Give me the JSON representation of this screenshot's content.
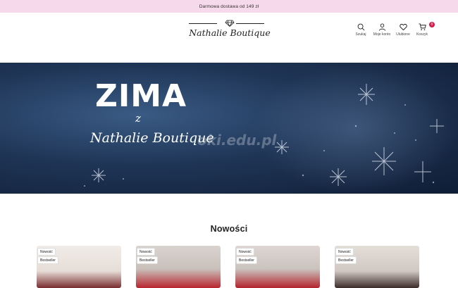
{
  "promo": {
    "text": "Darmowa dostawa od 149 zł"
  },
  "header": {
    "logo_text": "Nathalie Boutique",
    "actions": [
      {
        "label": "Szukaj",
        "icon": "search-icon"
      },
      {
        "label": "Moje konto",
        "icon": "user-icon"
      },
      {
        "label": "Ulubione",
        "icon": "heart-icon"
      },
      {
        "label": "Koszyk",
        "icon": "cart-icon",
        "badge": "0"
      }
    ]
  },
  "hero": {
    "title": "ZIMA",
    "connector": "z",
    "brand": "Nathalie Boutique",
    "watermark": "oki.edu.pl"
  },
  "section": {
    "title": "Nowości"
  },
  "products": [
    {
      "badges": [
        "Nowość",
        "Bestseller"
      ]
    },
    {
      "badges": [
        "Nowość",
        "Bestseller"
      ]
    },
    {
      "badges": [
        "Nowość",
        "Bestseller"
      ]
    },
    {
      "badges": [
        "Nowość",
        "Bestseller"
      ]
    }
  ],
  "colors": {
    "promo_bg": "#f6d9ea",
    "cart_badge": "#d21b4b",
    "hero_bg": "#1f3556"
  }
}
